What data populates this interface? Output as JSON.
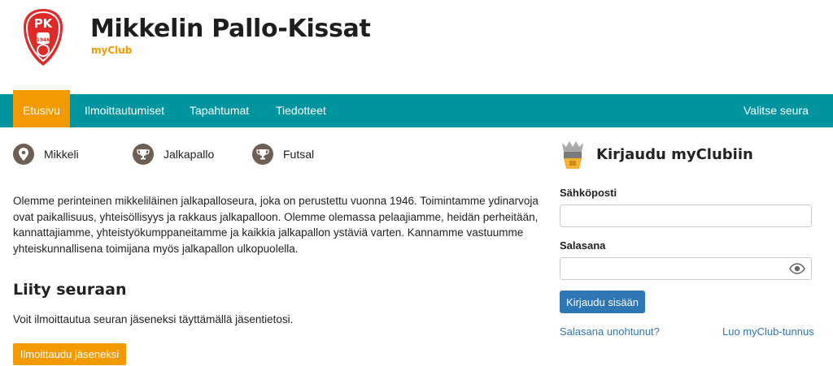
{
  "header": {
    "club_name": "Mikkelin Pallo-Kissat",
    "brand": "myClub",
    "logo_text": "PK",
    "logo_year": "1946"
  },
  "nav": {
    "items": [
      {
        "label": "Etusivu",
        "active": true
      },
      {
        "label": "Ilmoittautumiset"
      },
      {
        "label": "Tapahtumat"
      },
      {
        "label": "Tiedotteet"
      }
    ],
    "right_label": "Valitse seura"
  },
  "features": [
    {
      "icon": "location-pin-icon",
      "label": "Mikkeli"
    },
    {
      "icon": "trophy-icon",
      "label": "Jalkapallo"
    },
    {
      "icon": "trophy-icon",
      "label": "Futsal"
    }
  ],
  "description": "Olemme perinteinen mikkeliläinen jalkapalloseura, joka on perustettu vuonna 1946. Toimintamme ydinarvoja ovat paikallisuus, yhteisöllisyys ja rakkaus jalkapalloon. Olemme olemassa pelaajiamme, heidän perheitään, kannattajiamme, yhteistyökumppaneitamme ja kaikkia jalkapallon ystäviä varten. Kannamme vastuumme yhteiskunnallisena toimijana myös jalkapallon ulkopuolella.",
  "join": {
    "title": "Liity seuraan",
    "text": "Voit ilmoittautua seuran jäseneksi täyttämällä jäsentietosi.",
    "button": "Ilmoittaudu jäseneksi"
  },
  "login": {
    "title": "Kirjaudu myClubiin",
    "email_label": "Sähköposti",
    "email_value": "",
    "password_label": "Salasana",
    "password_value": "",
    "button": "Kirjaudu sisään",
    "forgot_link": "Salasana unohtunut?",
    "create_link": "Luo myClub-tunnus"
  },
  "colors": {
    "nav_bg": "#00959e",
    "accent": "#f29a00",
    "primary_button": "#2f77b4",
    "icon_bg": "#6d5f53",
    "logo_red": "#e02a2a"
  }
}
